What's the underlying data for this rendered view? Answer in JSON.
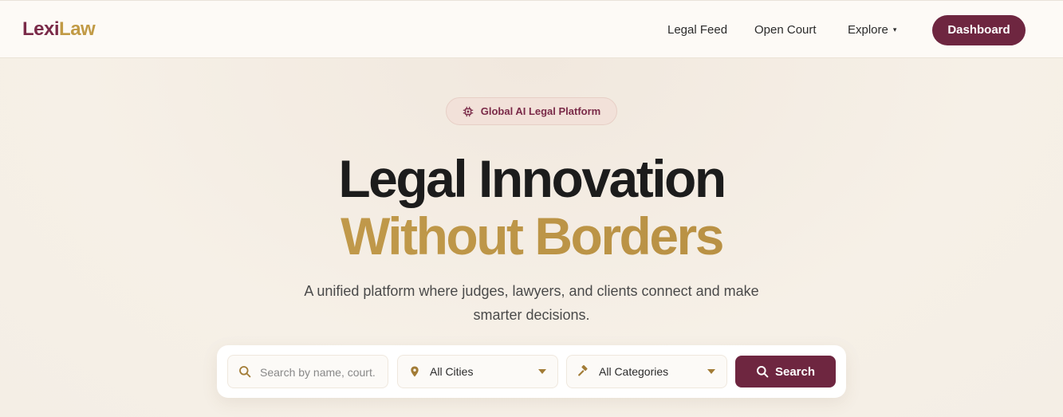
{
  "header": {
    "logo_part1": "Lexi",
    "logo_part2": "Law",
    "nav": {
      "legal_feed": "Legal Feed",
      "open_court": "Open Court",
      "explore": "Explore",
      "explore_caret": "▾"
    },
    "dashboard_label": "Dashboard"
  },
  "hero": {
    "badge_icon": "chip-icon",
    "badge_label": "Global AI Legal Platform",
    "title_line1": "Legal Innovation",
    "title_line2": "Without Borders",
    "subtitle": "A unified platform where judges, lawyers, and clients connect and make smarter decisions."
  },
  "search": {
    "placeholder": "Search by name, court...",
    "city_value": "All Cities",
    "category_value": "All Categories",
    "button_label": "Search"
  },
  "colors": {
    "brand_primary": "#6e2640",
    "brand_gold": "#c19a45",
    "background": "#f5efe6"
  },
  "icons": [
    "search-icon",
    "location-pin-icon",
    "gavel-icon",
    "chevron-down-icon",
    "chip-icon",
    "caret-down-icon"
  ]
}
